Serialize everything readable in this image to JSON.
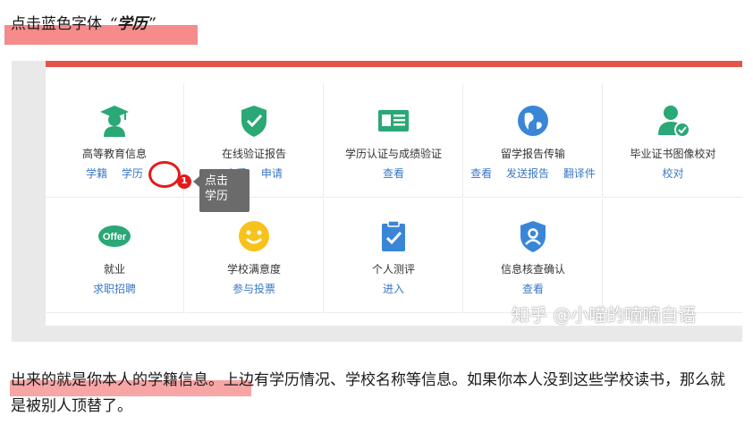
{
  "intro": {
    "prefix": "点击蓝色字体",
    "quote_open": "“",
    "emphasis": "学历",
    "quote_close": "”"
  },
  "panel": {
    "accent_color": "#e4544b",
    "link_color": "#3a78c4",
    "cells": [
      {
        "title": "高等教育信息",
        "links": [
          "学籍",
          "学历"
        ],
        "icon": "graduate-icon"
      },
      {
        "title": "在线验证报告",
        "links": [
          "查看",
          "申请"
        ],
        "icon": "shield-check-icon"
      },
      {
        "title": "学历认证与成绩验证",
        "links": [
          "查看"
        ],
        "icon": "id-card-icon"
      },
      {
        "title": "留学报告传输",
        "links": [
          "查看",
          "发送报告",
          "翻译件"
        ],
        "icon": "globe-icon"
      },
      {
        "title": "毕业证书图像校对",
        "links": [
          "校对"
        ],
        "icon": "user-check-icon"
      },
      {
        "title": "就业",
        "links": [
          "求职招聘"
        ],
        "icon": "offer-icon",
        "icon_text": "Offer"
      },
      {
        "title": "学校满意度",
        "links": [
          "参与投票"
        ],
        "icon": "smile-icon"
      },
      {
        "title": "个人测评",
        "links": [
          "进入"
        ],
        "icon": "clipboard-check-icon"
      },
      {
        "title": "信息核查确认",
        "links": [
          "查看"
        ],
        "icon": "shield-user-icon"
      }
    ],
    "annotation": {
      "badge": "1",
      "tooltip_line1": "点击",
      "tooltip_line2": "学历"
    },
    "watermark": "知乎 @小喵的喃喃自语"
  },
  "body_text": "出来的就是你本人的学籍信息。上边有学历情况、学校名称等信息。如果你本人没到这些学校读书，那么就是被别人顶替了。"
}
